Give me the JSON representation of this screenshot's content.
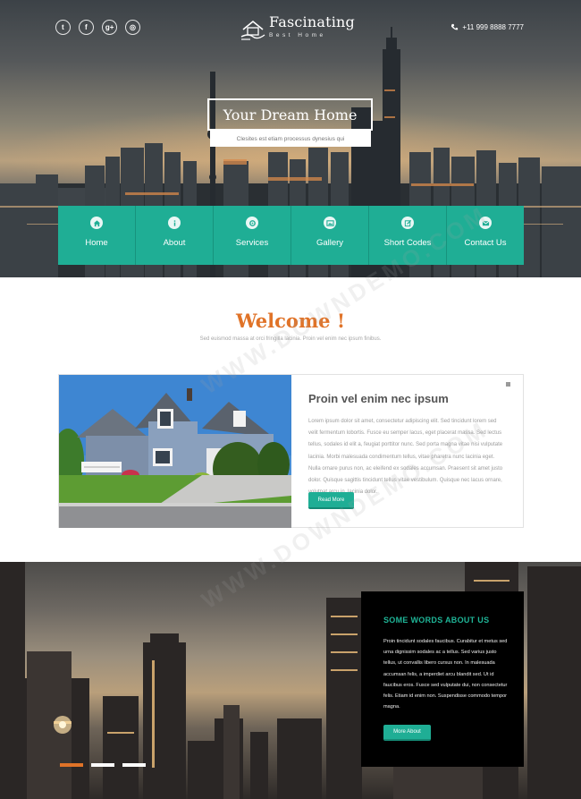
{
  "header": {
    "social": [
      {
        "icon": "twitter-icon",
        "glyph": "t"
      },
      {
        "icon": "facebook-icon",
        "glyph": "f"
      },
      {
        "icon": "google-plus-icon",
        "glyph": "g+"
      },
      {
        "icon": "dribbble-icon",
        "glyph": "◎"
      }
    ],
    "logo_title": "Fascinating",
    "logo_subtitle": "Best Home",
    "phone": "+11 999 8888 7777"
  },
  "hero": {
    "title": "Your Dream Home",
    "subtitle": "Clesites est etiam processus dynesius qui"
  },
  "nav": {
    "items": [
      {
        "label": "Home",
        "icon": "home-icon"
      },
      {
        "label": "About",
        "icon": "info-icon"
      },
      {
        "label": "Services",
        "icon": "gear-icon"
      },
      {
        "label": "Gallery",
        "icon": "image-icon"
      },
      {
        "label": "Short Codes",
        "icon": "edit-icon"
      },
      {
        "label": "Contact Us",
        "icon": "mail-icon"
      }
    ]
  },
  "welcome": {
    "title": "Welcome !",
    "subtitle": "Sed euismod massa at orci fringilla lacinia. Proin vel enim nec ipsum finibus."
  },
  "feature": {
    "title": "Proin vel enim nec ipsum",
    "body": "Lorem ipsum dolor sit amet, consectetur adipiscing elit. Sed tincidunt lorem sed velit fermentum lobortis. Fusce eu semper lacus, eget placerat massa. Sed lectus tellus, sodales id elit a, feugiat porttitor nunc. Sed porta magna vitae nisi vulputate lacinia. Morbi malesuada condimentum tellus, vitae pharetra nunc lacinia eget. Nulla ornare purus non, ac eleifend ex sodales accumsan. Praesent sit amet justo dolor. Quisque sagittis tincidunt tellus vitae vestibulum. Quisque nec lacus ornare, volutpat arcu in, lacinia dolor.",
    "button": "Read More"
  },
  "about": {
    "title": "SOME WORDS ABOUT US",
    "body": "Proin tincidunt sodales faucibus. Curabitur et metus sed urna dignissim sodales ac a tellus. Sed varius justo tellus, ut convallis libero cursus non. In malesuada accumsan felis, a imperdiet arcu blandit sed. Ut id faucibus eros. Fusce sed vulputate dui, non consectetur felis. Etiam id enim non. Suspendisse commodo tempor magna.",
    "button": "More About"
  },
  "slider": {
    "dots": [
      {
        "label": "slide 1",
        "active": true
      },
      {
        "label": "slide 2",
        "active": false
      },
      {
        "label": "slide 3",
        "active": false
      }
    ]
  },
  "watermark": "WWW.DOWNDEMO.COM",
  "colors": {
    "accent": "#1fae95",
    "orange": "#e07328",
    "about_bg": "#000000"
  }
}
